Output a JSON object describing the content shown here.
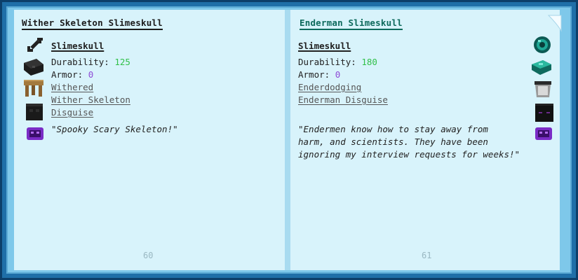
{
  "left_page": {
    "title": "Wither Skeleton Slimeskull",
    "item_name": "Slimeskull",
    "durability_label": "Durability:",
    "durability_value": "125",
    "armor_label": "Armor:",
    "armor_value": "0",
    "modifiers": [
      "Withered",
      "Wither Skeleton",
      "Disguise"
    ],
    "quote": "\"Spooky Scary Skeleton!\"",
    "page_number": "60",
    "icons": [
      "bone-icon",
      "coal-block-icon",
      "wood-table-icon",
      "wither-skull-icon",
      "purple-slime-icon"
    ]
  },
  "right_page": {
    "title": "Enderman Slimeskull",
    "item_name": "Slimeskull",
    "durability_label": "Durability:",
    "durability_value": "180",
    "armor_label": "Armor:",
    "armor_value": "0",
    "modifiers": [
      "Enderdodging",
      "Enderman Disguise"
    ],
    "quote_lines": [
      "\"Endermen know how to stay away from",
      "harm, and scientists. They have been",
      "ignoring my interview requests for weeks!\""
    ],
    "page_number": "61",
    "icons": [
      "ender-pearl-icon",
      "ender-slab-icon",
      "bucket-icon",
      "enderman-head-icon",
      "purple-slime-icon"
    ]
  },
  "colors": {
    "frame": "#1f6fa8",
    "page": "#d8f3fb",
    "durability": "#32c04a",
    "armor": "#8e4bd6",
    "teal_title": "#0d6a5c"
  }
}
